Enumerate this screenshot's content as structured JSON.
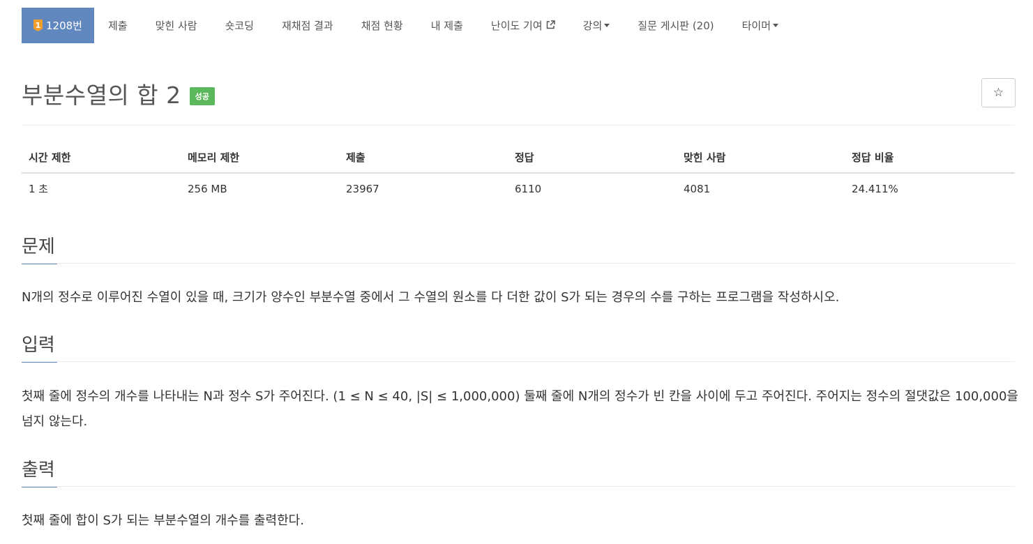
{
  "nav": {
    "problem_number": "1208번",
    "tier_badge": "1",
    "items": [
      {
        "label": "제출"
      },
      {
        "label": "맞힌 사람"
      },
      {
        "label": "숏코딩"
      },
      {
        "label": "재채점 결과"
      },
      {
        "label": "채점 현황"
      },
      {
        "label": "내 제출"
      },
      {
        "label": "난이도 기여"
      },
      {
        "label": "강의"
      },
      {
        "label": "질문 게시판 (20)"
      },
      {
        "label": "타이머"
      }
    ],
    "external_icon": "external-link-icon",
    "dropdown_icon": "caret-down-icon"
  },
  "problem": {
    "title": "부분수열의 합 2",
    "status": "성공",
    "star_icon": "☆"
  },
  "info": {
    "headers": [
      "시간 제한",
      "메모리 제한",
      "제출",
      "정답",
      "맞힌 사람",
      "정답 비율"
    ],
    "values": [
      "1 초",
      "256 MB",
      "23967",
      "6110",
      "4081",
      "24.411%"
    ]
  },
  "sections": {
    "problem": {
      "heading": "문제",
      "body": "N개의 정수로 이루어진 수열이 있을 때, 크기가 양수인 부분수열 중에서 그 수열의 원소를 다 더한 값이 S가 되는 경우의 수를 구하는 프로그램을 작성하시오."
    },
    "input": {
      "heading": "입력",
      "body": "첫째 줄에 정수의 개수를 나타내는 N과 정수 S가 주어진다. (1 ≤ N ≤ 40, |S| ≤ 1,000,000) 둘째 줄에 N개의 정수가 빈 칸을 사이에 두고 주어진다. 주어지는 정수의 절댓값은 100,000을 넘지 않는다."
    },
    "output": {
      "heading": "출력",
      "body": "첫째 줄에 합이 S가 되는 부분수열의 개수를 출력한다."
    }
  },
  "colors": {
    "accent": "#6187bf",
    "success": "#5cb85c",
    "tier_gold": "#f0a02a"
  }
}
